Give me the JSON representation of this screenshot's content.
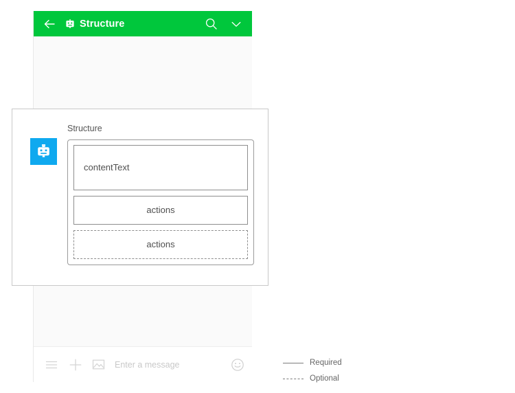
{
  "header": {
    "title": "Structure",
    "back_icon": "arrow-left-icon",
    "bot_icon": "robot-icon",
    "search_icon": "search-icon",
    "chevron_icon": "chevron-down-icon",
    "background_color": "#00C73C",
    "text_color": "#FFFFFF"
  },
  "input_bar": {
    "menu_icon": "hamburger-menu-icon",
    "plus_icon": "plus-icon",
    "image_icon": "image-icon",
    "emoji_icon": "emoji-smiley-icon",
    "placeholder": "Enter a message",
    "value": ""
  },
  "card": {
    "avatar_icon": "robot-avatar-icon",
    "avatar_color": "#0FA9EF",
    "sender_name": "Structure",
    "slots": [
      {
        "label": "contentText",
        "style": "required",
        "align": "left"
      },
      {
        "label": "actions",
        "style": "required",
        "align": "center"
      },
      {
        "label": "actions",
        "style": "optional",
        "align": "center"
      }
    ]
  },
  "legend": {
    "items": [
      {
        "label": "Required",
        "style": "solid"
      },
      {
        "label": "Optional",
        "style": "dashed"
      }
    ],
    "line_color": "#7C7C7C"
  }
}
